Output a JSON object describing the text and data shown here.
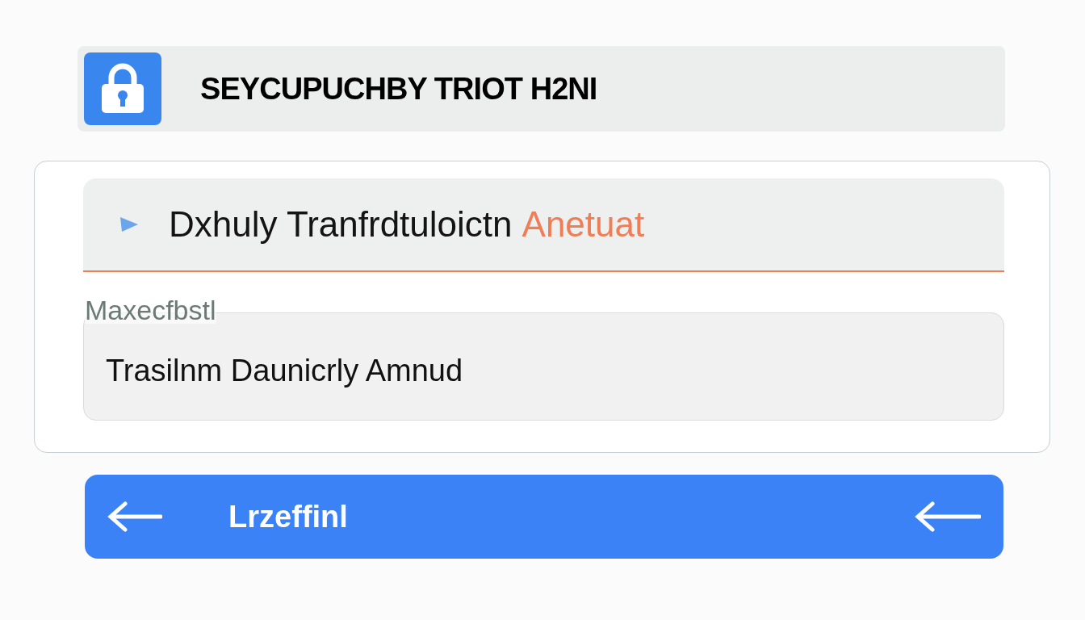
{
  "header": {
    "title": "SEYCUPUCHBY TRIOT H2NI"
  },
  "row": {
    "title": "Dxhuly Tranfrdtuloictn",
    "highlight": "Anetuat"
  },
  "field": {
    "label": "Maxecfbstl",
    "value": "Trasilnm Daunicrly Amnud"
  },
  "button": {
    "label": "Lrzeffinl"
  }
}
